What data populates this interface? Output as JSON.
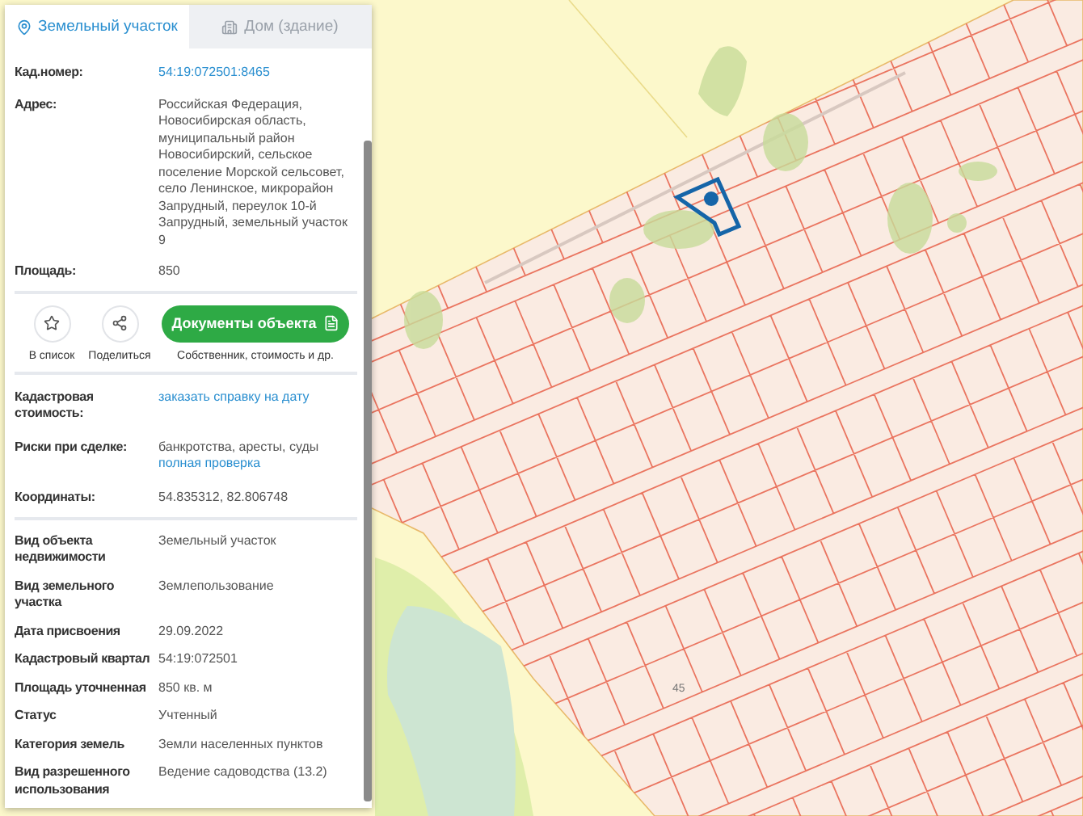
{
  "tabs": [
    {
      "label": "Земельный участок",
      "selected": true
    },
    {
      "label": "Дом (здание)",
      "selected": false
    }
  ],
  "main_info": [
    {
      "label": "Кад.номер:",
      "lines": [
        {
          "text": "54:19:072501:8465",
          "kind": "link"
        }
      ]
    },
    {
      "label": "Адрес:",
      "lines": [
        {
          "text": "Российская Федерация, Новосибирская область, муниципальный район Новосибирский, сельское поселение Морской сельсовет, село Ленинское, микрорайон Запрудный, переулок 10-й Запрудный, земельный участок 9",
          "kind": "text"
        }
      ]
    },
    {
      "label": "Площадь:",
      "lines": [
        {
          "text": "850",
          "kind": "text"
        }
      ]
    }
  ],
  "actions": {
    "round_buttons": [
      {
        "label": "В список"
      },
      {
        "label": "Поделиться"
      }
    ],
    "documents_button": "Документы объекта",
    "documents_caption": "Собственник, стоимость и др."
  },
  "extra_info": [
    {
      "label": "Кадастровая стоимость:",
      "lines": [
        {
          "text": "заказать справку на дату",
          "kind": "link"
        }
      ]
    },
    {
      "label": "Риски при сделке:",
      "lines": [
        {
          "text": "банкротства, аресты, суды",
          "kind": "text"
        },
        {
          "text": "полная проверка",
          "kind": "link"
        }
      ]
    },
    {
      "label": "Координаты:",
      "lines": [
        {
          "text": "54.835312, 82.806748",
          "kind": "text"
        }
      ]
    }
  ],
  "details": [
    {
      "label": "Вид объекта недвижимости",
      "lines": [
        {
          "text": "Земельный участок",
          "kind": "text"
        }
      ]
    },
    {
      "label": "Вид земельного участка",
      "lines": [
        {
          "text": "Землепользование",
          "kind": "text"
        }
      ]
    },
    {
      "label": "Дата присвоения",
      "lines": [
        {
          "text": "29.09.2022",
          "kind": "text"
        }
      ]
    },
    {
      "label": "Кадастровый квартал",
      "lines": [
        {
          "text": "54:19:072501",
          "kind": "text"
        }
      ]
    },
    {
      "label": "Площадь уточненная",
      "lines": [
        {
          "text": "850 кв. м",
          "kind": "text"
        }
      ]
    },
    {
      "label": "Статус",
      "lines": [
        {
          "text": "Учтенный",
          "kind": "text"
        }
      ]
    },
    {
      "label": "Категория земель",
      "lines": [
        {
          "text": "Земли населенных пунктов",
          "kind": "text"
        }
      ]
    },
    {
      "label": "Вид разрешенного использования",
      "lines": [
        {
          "text": "Ведение садоводства (13.2)",
          "kind": "text"
        }
      ]
    }
  ],
  "map": {
    "parcel_number": "45"
  }
}
